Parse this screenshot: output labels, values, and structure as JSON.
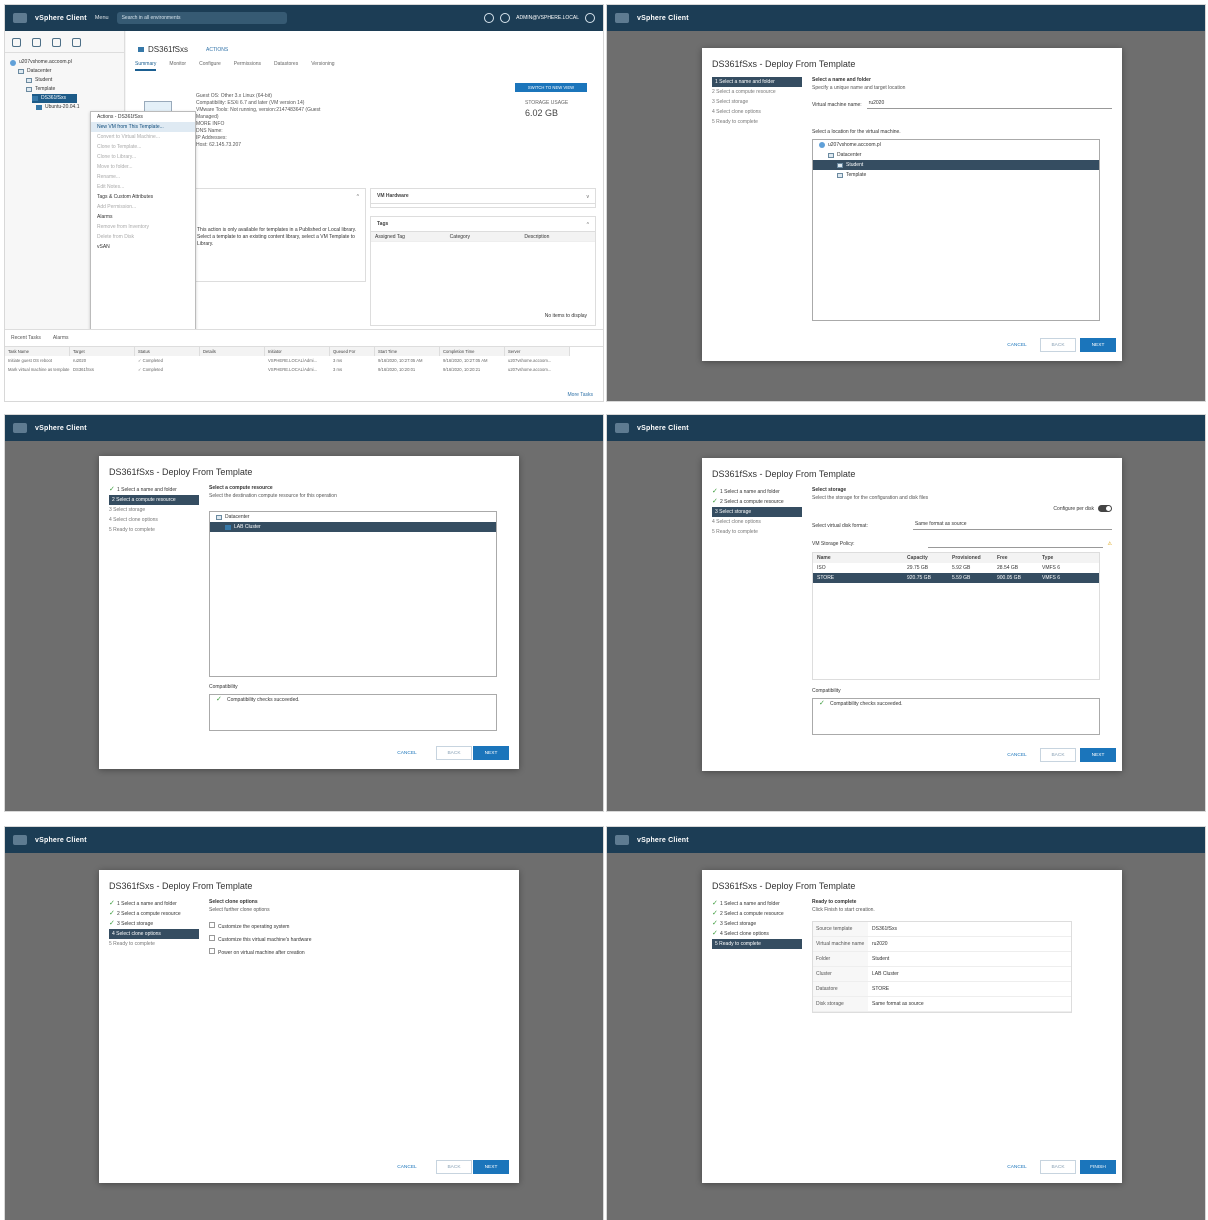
{
  "app": {
    "brand": "vSphere Client",
    "menu": "Menu",
    "search_placeholder": "Search in all environments",
    "user": "ADMIN@VSPHERE.LOCAL"
  },
  "colors": {
    "topbar": "#1c3d55",
    "selection": "#354d61",
    "primary_button": "#1b75bb"
  },
  "panel1": {
    "object_title": "DS361fSxs",
    "actions": "ACTIONS",
    "tabs": [
      "Summary",
      "Monitor",
      "Configure",
      "Permissions",
      "Datastores",
      "Versioning"
    ],
    "tree": [
      "u207vshome.accoom.pl",
      "Datacenter",
      "Student",
      "Template",
      "DS361fSxs",
      "Ubuntu-20.04.1"
    ],
    "kv": [
      "Guest OS:",
      "Compatibility:",
      "VMware Tools:",
      "DNS Name:",
      "IP Addresses:",
      "Host:"
    ],
    "kv_values": [
      "Other 3.x Linux (64-bit)",
      "ESXi 6.7 and later (VM version 14)",
      "Not running, version:2147483647 (Guest Managed)",
      "MORE INFO",
      "",
      "62.145.73.207"
    ],
    "switch_button": "SWITCH TO NEW VIEW",
    "storage_label": "STORAGE USAGE",
    "storage_value": "6.02 GB",
    "menu_items": [
      "Actions - DS361fSxs",
      "New VM from This Template...",
      "Convert to Virtual Machine...",
      "Clone to Template...",
      "Clone to Library...",
      "Move to folder...",
      "Rename...",
      "Edit Notes...",
      "Tags & Custom Attributes",
      "Add Permission...",
      "Alarms",
      "Remove from Inventory",
      "Delete from Disk",
      "vSAN"
    ],
    "card_vm_hardware": "VM Hardware",
    "card_tags": "Tags",
    "tags_headers": [
      "Assigned Tag",
      "Category",
      "Description"
    ],
    "note_text": "This action is only available for templates in a Published or Local library. Select a template to an existing content library, select a VM Template to Library.",
    "no_items": "No items to display"
  },
  "bottom": {
    "tabs": [
      "Recent Tasks",
      "Alarms"
    ],
    "headers": [
      "Task Name",
      "Target",
      "Status",
      "Details",
      "Initiator",
      "Queued For",
      "Start Time",
      "Completion Time",
      "Server"
    ],
    "rows": [
      [
        "Initiate guest OS reboot",
        "ru2020",
        "✓ Completed",
        "",
        "VSPHERE.LOCAL\\Admi...",
        "3 ms",
        "9/16/2020, 10:27:05 AM",
        "9/16/2020, 10:27:05 AM",
        "u207vshome.accoom..."
      ],
      [
        "Mark virtual machine as template",
        "DS361fSxs",
        "✓ Completed",
        "",
        "VSPHERE.LOCAL\\Admi...",
        "3 ms",
        "9/16/2020, 10:20:01",
        "9/16/2020, 10:20:21",
        "u207vshome.accoom..."
      ],
      [
        "Power Off virtual machine",
        "DS361fSxs",
        "✓ Completed",
        "",
        "VSPHERE.LOCAL\\Admi...",
        "3 ms",
        "9/16/2020, 10:19:02",
        "9/16/2020, 10:19:03",
        "u207vshome.accoom..."
      ]
    ],
    "more_tasks": "More Tasks",
    "all_select": "All"
  },
  "wizard": {
    "title": "DS361fSxs - Deploy From Template",
    "steps": [
      "1 Select a name and folder",
      "2 Select a compute resource",
      "3 Select storage",
      "4 Select clone options",
      "5 Ready to complete"
    ],
    "buttons": {
      "cancel": "CANCEL",
      "back": "BACK",
      "next": "NEXT",
      "finish": "FINISH"
    },
    "step1": {
      "head": "Select a name and folder",
      "sub": "Specify a unique name and target location",
      "name_label": "Virtual machine name:",
      "name_value": "ru2020",
      "location_label": "Select a location for the virtual machine.",
      "tree": [
        "u207vshome.accoom.pl",
        "Datacenter",
        "Student",
        "Template"
      ]
    },
    "step2": {
      "head": "Select a compute resource",
      "sub": "Select the destination compute resource for this operation",
      "tree": [
        "Datacenter",
        "LAB Cluster"
      ],
      "compat_label": "Compatibility",
      "compat_text": "Compatibility checks succeeded."
    },
    "step3": {
      "head": "Select storage",
      "sub": "Select the storage for the configuration and disk files",
      "configure_per_disk": "Configure per disk",
      "disk_format_label": "Select virtual disk format:",
      "disk_format_value": "Same format as source",
      "policy_label": "VM Storage Policy:",
      "headers": [
        "Name",
        "Capacity",
        "Provisioned",
        "Free",
        "Type"
      ],
      "rows": [
        [
          "ISO",
          "29.75 GB",
          "5.92 GB",
          "28.54 GB",
          "VMFS 6"
        ],
        [
          "STORE",
          "920.75 GB",
          "5.59 GB",
          "900.05 GB",
          "VMFS 6"
        ]
      ],
      "compat_label": "Compatibility",
      "compat_text": "Compatibility checks succeeded."
    },
    "step4": {
      "head": "Select clone options",
      "sub": "Select further clone options",
      "options": [
        "Customize the operating system",
        "Customize this virtual machine's hardware",
        "Power on virtual machine after creation"
      ]
    },
    "step5": {
      "head": "Ready to complete",
      "sub": "Click Finish to start creation.",
      "rows": [
        [
          "Source template",
          "DS361fSxs"
        ],
        [
          "Virtual machine name",
          "ru2020"
        ],
        [
          "Folder",
          "Student"
        ],
        [
          "Cluster",
          "LAB Cluster"
        ],
        [
          "Datastore",
          "STORE"
        ],
        [
          "Disk storage",
          "Same format as source"
        ]
      ]
    }
  }
}
